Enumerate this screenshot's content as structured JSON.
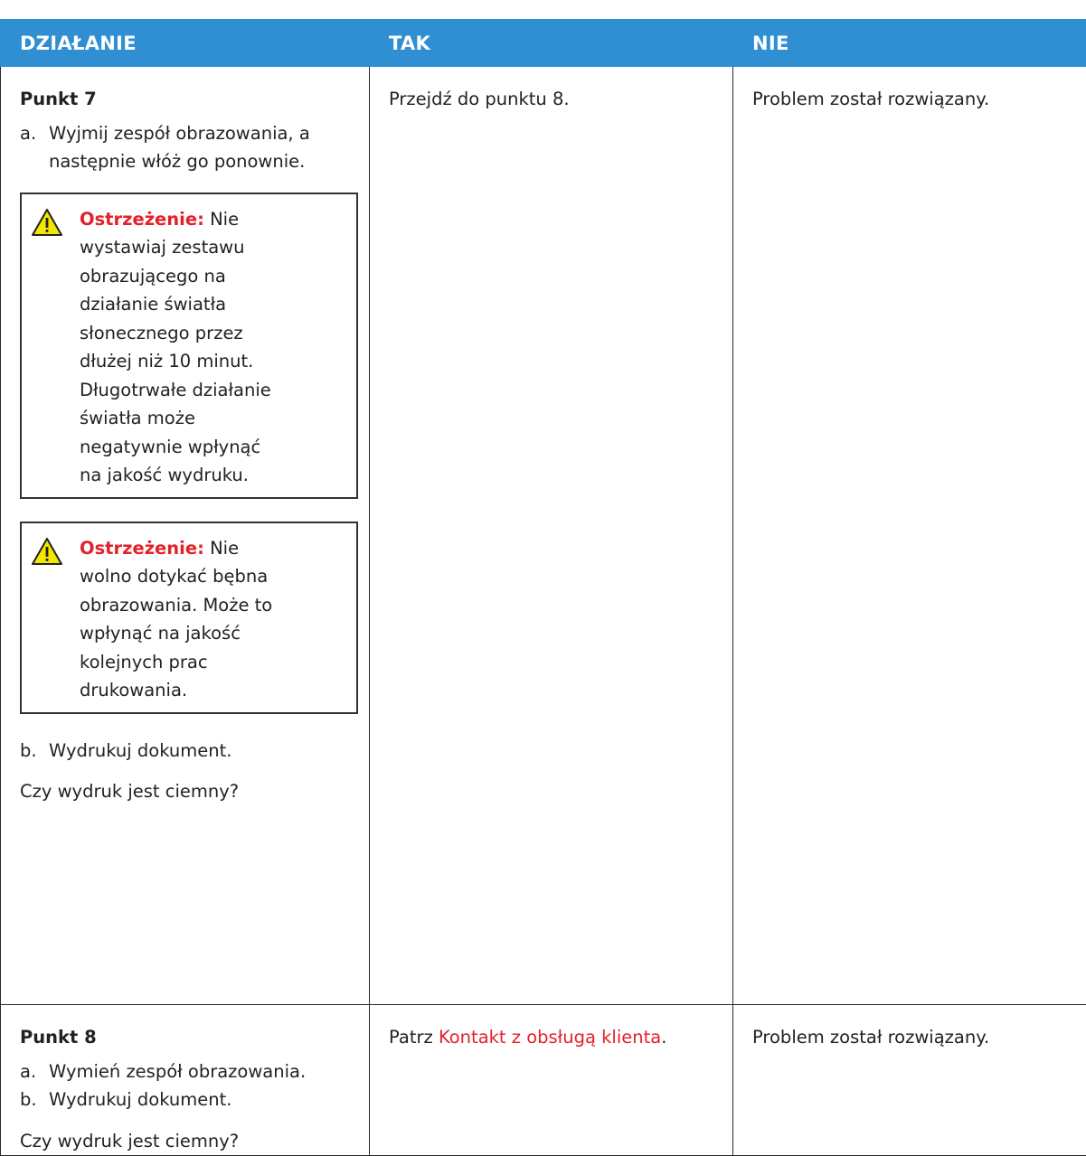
{
  "header": {
    "col1": "DZIAŁANIE",
    "col2": "TAK",
    "col3": "NIE"
  },
  "row1": {
    "step_title": "Punkt 7",
    "item_a_label": "a.",
    "item_a_text": "Wyjmij zespół obrazowania, a następnie włóż go ponownie.",
    "warning1_title": "Ostrzeżenie:",
    "warning1_text": "Nie wystawiaj zestawu obrazującego na działanie światła słonecznego przez dłużej niż 10 minut. Długotrwałe działanie światła może negatywnie wpłynąć na jakość wydruku.",
    "warning2_title": "Ostrzeżenie:",
    "warning2_text": "Nie wolno dotykać bębna obrazowania. Może to wpłynąć na jakość kolejnych prac drukowania.",
    "item_b_label": "b.",
    "item_b_text": "Wydrukuj dokument.",
    "question": "Czy wydruk jest ciemny?",
    "yes": "Przejdź do punktu 8.",
    "no": "Problem został rozwiązany."
  },
  "row2": {
    "step_title": "Punkt 8",
    "item_a_label": "a.",
    "item_a_text": "Wymień zespół obrazowania.",
    "item_b_label": "b.",
    "item_b_text": "Wydrukuj dokument.",
    "question": "Czy wydruk jest ciemny?",
    "yes_prefix": "Patrz",
    "yes_link": "Kontakt z obsługą klienta",
    "yes_suffix": ".",
    "no": "Problem został rozwiązany."
  },
  "icons": {
    "warning": "warning-triangle-icon"
  },
  "colors": {
    "header_bg": "#2f8fd2",
    "warning_title": "#e3212b",
    "link": "#e3212b",
    "warning_icon_fill": "#f3e600"
  }
}
